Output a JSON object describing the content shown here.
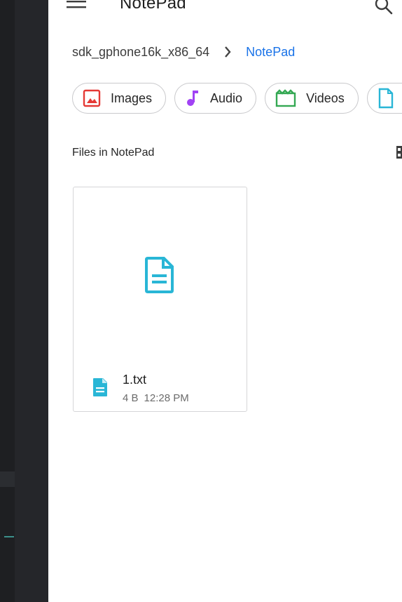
{
  "app_bar": {
    "title": "NotePad"
  },
  "breadcrumb": {
    "root": "sdk_gphone16k_x86_64",
    "current": "NotePad"
  },
  "chips": [
    {
      "label": "Images",
      "icon": "image-icon",
      "color": "#e53935"
    },
    {
      "label": "Audio",
      "icon": "music-note-icon",
      "color": "#a142f4"
    },
    {
      "label": "Videos",
      "icon": "movie-icon",
      "color": "#34a853"
    },
    {
      "label": "",
      "icon": "document-icon",
      "color": "#29b6d6"
    }
  ],
  "section": {
    "title": "Files in NotePad"
  },
  "files": [
    {
      "name": "1.txt",
      "size": "4 B",
      "time": "12:28 PM",
      "icon": "text-file-icon",
      "icon_color": "#29b6d6"
    }
  ],
  "colors": {
    "accent": "#1a73e8",
    "scrim": "#25262a",
    "file_icon": "#29b6d6"
  }
}
